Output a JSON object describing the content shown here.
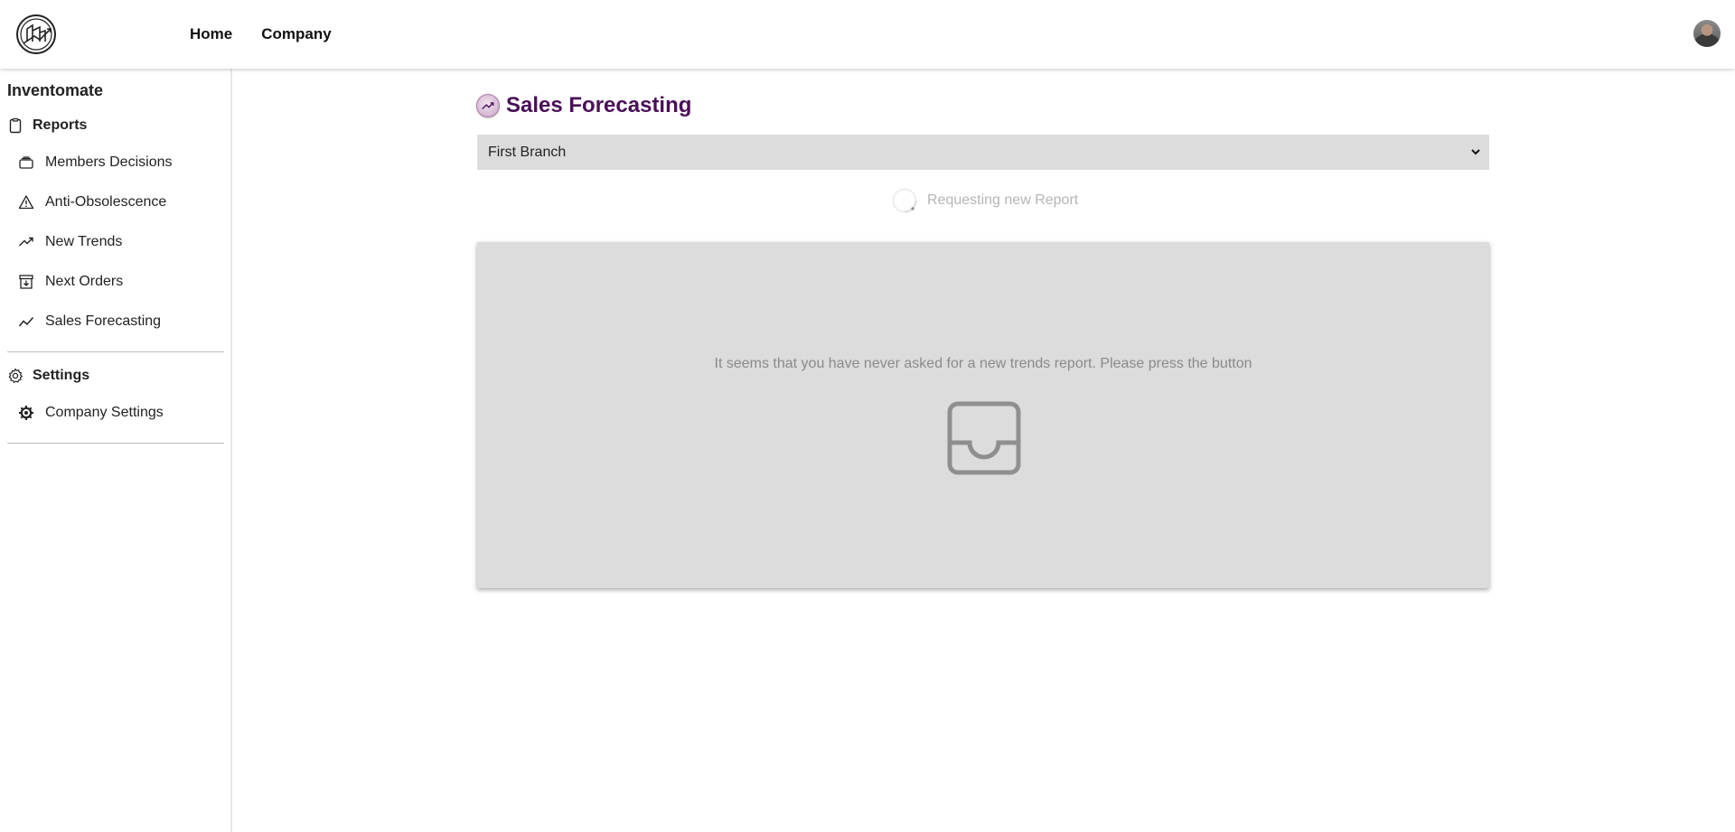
{
  "topnav": {
    "items": [
      {
        "label": "Home"
      },
      {
        "label": "Company"
      }
    ]
  },
  "sidebar": {
    "brand": "Inventomate",
    "sections": [
      {
        "title": "Reports",
        "icon": "clipboard-icon",
        "items": [
          {
            "label": "Members Decisions",
            "icon": "stack-icon"
          },
          {
            "label": "Anti-Obsolescence",
            "icon": "warning-icon"
          },
          {
            "label": "New Trends",
            "icon": "trending-up-icon"
          },
          {
            "label": "Next Orders",
            "icon": "archive-down-icon"
          },
          {
            "label": "Sales Forecasting",
            "icon": "line-chart-icon"
          }
        ]
      },
      {
        "title": "Settings",
        "icon": "gear-icon",
        "items": [
          {
            "label": "Company Settings",
            "icon": "cog-icon"
          }
        ]
      }
    ]
  },
  "main": {
    "title": "Sales Forecasting",
    "title_icon": "trending-up-icon",
    "branch_select": {
      "selected": "First Branch"
    },
    "status": "Requesting new Report",
    "empty_state": {
      "message": "It seems that you have never asked for a new trends report. Please press the button",
      "icon": "inbox-icon"
    }
  },
  "colors": {
    "title": "#4a0f57",
    "panel": "#dcdcdc",
    "muted_text": "#8a8a8a"
  }
}
